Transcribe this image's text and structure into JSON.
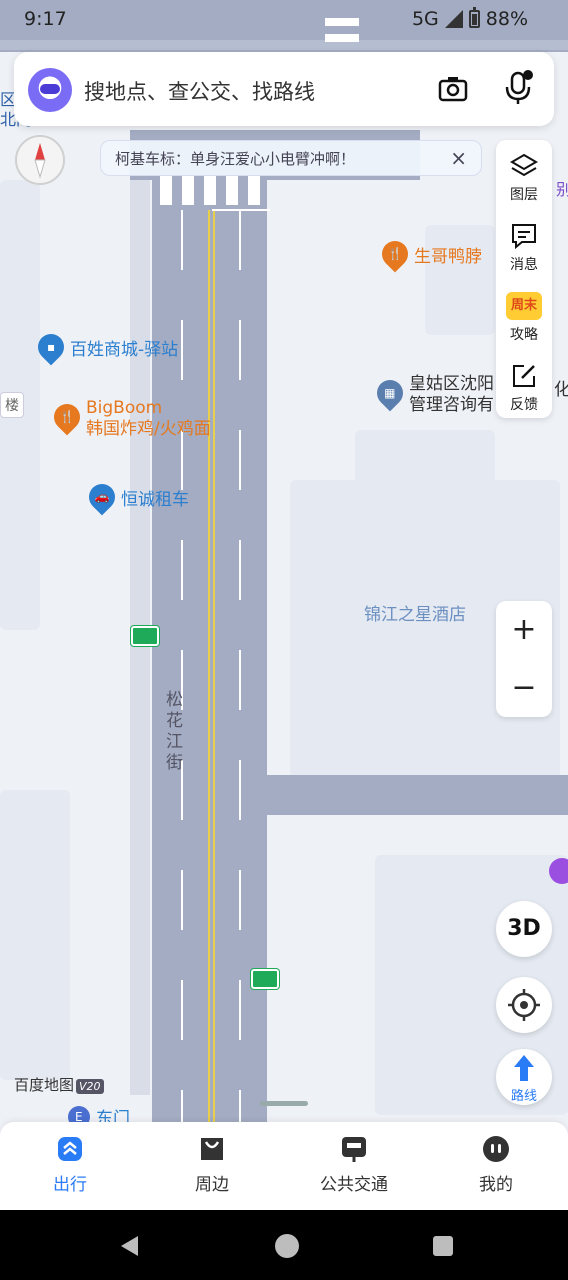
{
  "status_bar": {
    "time": "9:17",
    "network": "5G",
    "battery": "88%"
  },
  "search": {
    "placeholder": "搜地点、查公交、找路线"
  },
  "notice": {
    "text": "柯基车标：单身汪爱心小电臂冲啊！",
    "close": "×"
  },
  "tools": [
    {
      "label": "图层",
      "icon": "layers-icon"
    },
    {
      "label": "消息",
      "icon": "message-icon"
    },
    {
      "label": "攻略",
      "icon": "weekend-guide-icon",
      "badge": "周末"
    },
    {
      "label": "反馈",
      "icon": "feedback-edit-icon"
    }
  ],
  "zoom": {
    "in": "+",
    "out": "−"
  },
  "map": {
    "street": "松花江街",
    "pois": [
      {
        "name": "生哥鸭脖",
        "kind": "food"
      },
      {
        "name": "百姓商城-驿站",
        "kind": "shop"
      },
      {
        "name_line1": "BigBoom",
        "name_line2": "韩国炸鸡/火鸡面",
        "kind": "food"
      },
      {
        "name": "恒诚租车",
        "kind": "car"
      },
      {
        "name_line1": "皇姑区沈阳",
        "name_line2": "管理咨询有",
        "kind": "office"
      },
      {
        "name": "锦江之星酒店",
        "kind": "hotel"
      },
      {
        "name": "东门",
        "kind": "gate"
      }
    ],
    "edge_left_top": "区\n北门",
    "edge_left_mid": "楼",
    "edge_right_top": "别",
    "edge_right_mid": "化"
  },
  "buttons": {
    "three_d": "3D",
    "route": "路线"
  },
  "brand": {
    "name": "百度地图",
    "version": "V20"
  },
  "tabs": [
    {
      "label": "出行",
      "active": true
    },
    {
      "label": "周边",
      "active": false
    },
    {
      "label": "公共交通",
      "active": false
    },
    {
      "label": "我的",
      "active": false
    }
  ],
  "colors": {
    "accent": "#2a7bf6",
    "road": "#a3acc2",
    "poi_blue": "#2c7fcf",
    "poi_orange": "#e6781f"
  }
}
